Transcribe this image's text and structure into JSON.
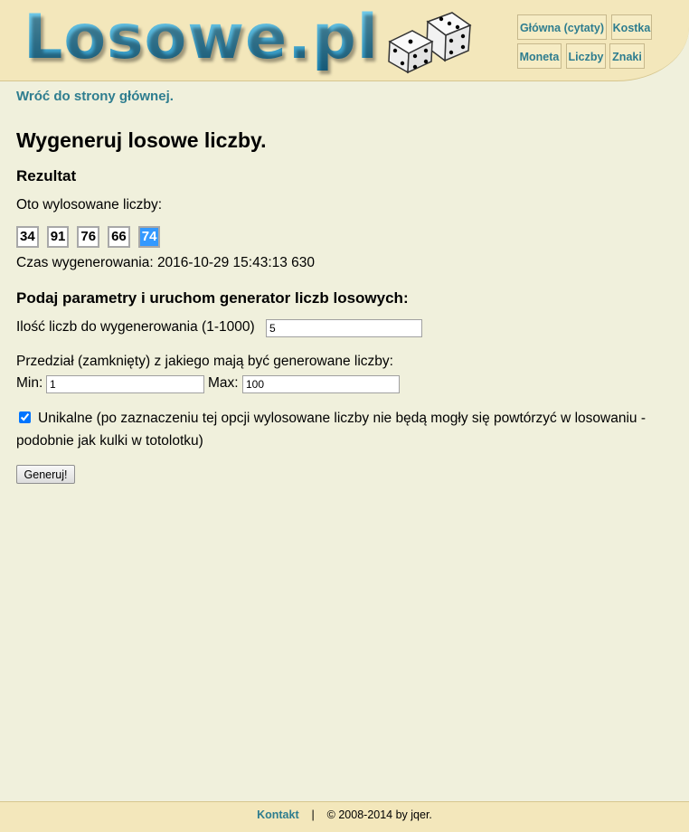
{
  "header": {
    "logo": "Losowe.pl",
    "nav": [
      "Główna (cytaty)",
      "Kostka",
      "Moneta",
      "Liczby",
      "Znaki"
    ]
  },
  "back_link": "Wróć do strony głównej.",
  "title": "Wygeneruj losowe liczby.",
  "result": {
    "heading": "Rezultat",
    "intro": "Oto wylosowane liczby:",
    "numbers": [
      "34",
      "91",
      "76",
      "66",
      "74"
    ],
    "time": "Czas wygenerowania: 2016-10-29 15:43:13 630"
  },
  "form": {
    "heading": "Podaj parametry i uruchom generator liczb losowych:",
    "count_label": "Ilość liczb do wygenerowania (1-1000)",
    "count_value": "5",
    "range_label": "Przedział (zamknięty) z jakiego mają być generowane liczby:",
    "min_label": "Min:",
    "min_value": "1",
    "max_label": "Max:",
    "max_value": "100",
    "unique_checked": true,
    "unique_line1": "Unikalne (po zaznaczeniu tej opcji wylosowane liczby nie będą mogły się powtórzyć w losowaniu -",
    "unique_line2": "podobnie jak kulki w totolotku)",
    "submit": "Generuj!"
  },
  "footer": {
    "contact": "Kontakt",
    "separator": "|",
    "copyright": "© 2008-2014 by jqer."
  }
}
